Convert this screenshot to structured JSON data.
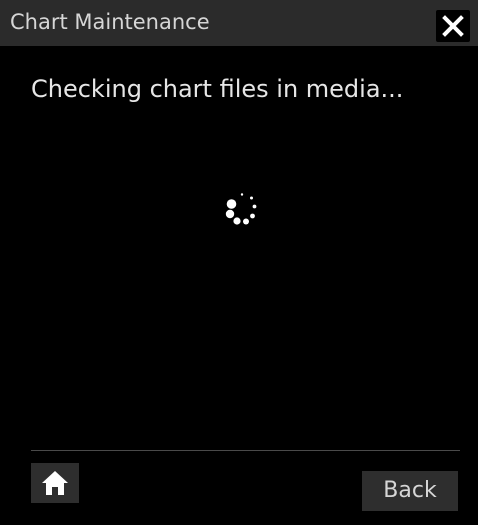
{
  "window": {
    "title": "Chart Maintenance",
    "close_icon": "close-icon"
  },
  "main": {
    "status_message": "Checking chart files in media...",
    "spinner_icon": "loading-spinner-icon"
  },
  "footer": {
    "home_icon": "home-icon",
    "back_label": "Back"
  },
  "colors": {
    "background": "#000000",
    "title_bar": "#2b2b2b",
    "button": "#2e2e2e",
    "text": "#e6e6e6"
  }
}
